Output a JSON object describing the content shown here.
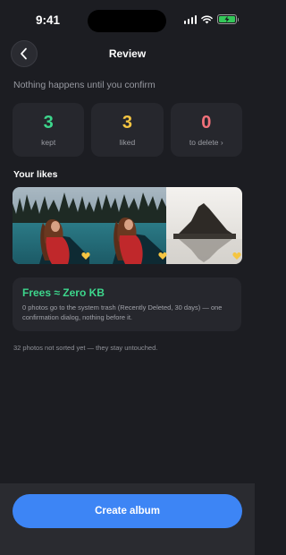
{
  "status_bar": {
    "time": "9:41"
  },
  "header": {
    "title": "Review"
  },
  "subtitle": "Nothing happens until you confirm",
  "stats": [
    {
      "value": "3",
      "label": "kept",
      "color": "#3dd68c"
    },
    {
      "value": "3",
      "label": "liked",
      "color": "#f5c542"
    },
    {
      "value": "0",
      "label": "to delete ›",
      "color": "#f2717a"
    }
  ],
  "likes": {
    "title": "Your likes",
    "photos": [
      {
        "name": "woman-in-red-canoe"
      },
      {
        "name": "woman-in-red-canoe"
      },
      {
        "name": "mountain-island-lake"
      }
    ]
  },
  "info": {
    "title": "Frees ≈ Zero KB",
    "body": "0 photos go to the system trash (Recently Deleted, 30 days) — one confirmation dialog, nothing before it."
  },
  "footnote": "32 photos not sorted yet — they stay untouched.",
  "actions": {
    "create_album": "Create album"
  },
  "colors": {
    "background": "#1c1d22",
    "card": "#26272d",
    "accent_blue": "#3d85f5",
    "green": "#3dd68c",
    "yellow": "#f5c542",
    "red": "#f2717a"
  }
}
